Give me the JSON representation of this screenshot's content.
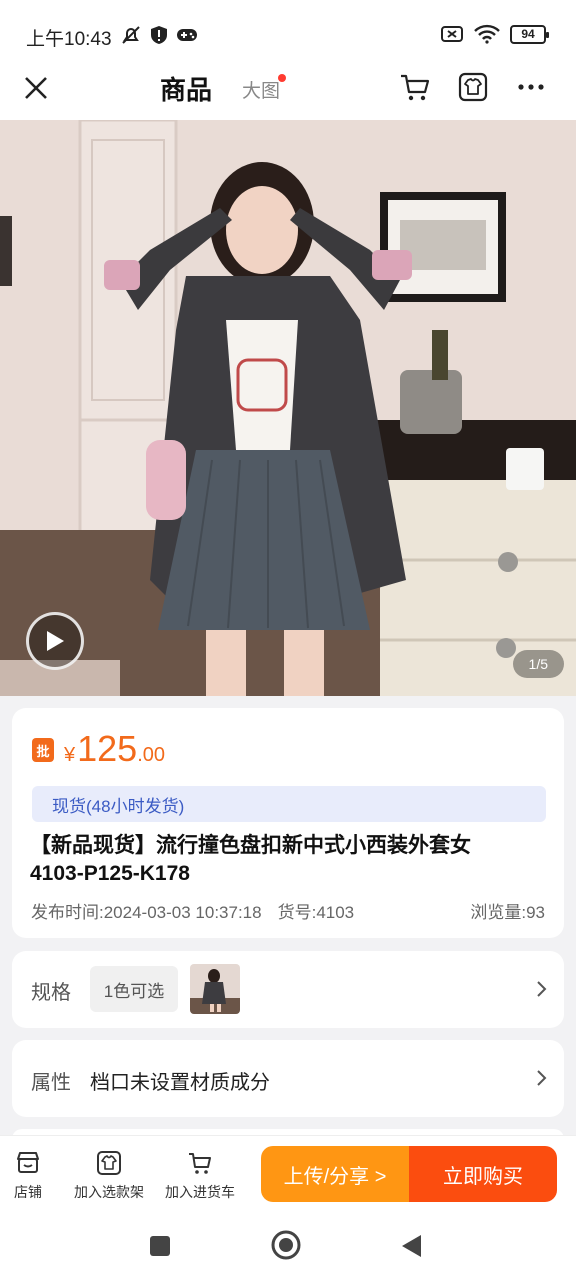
{
  "status_bar": {
    "time": "上午10:43",
    "battery": "94"
  },
  "nav": {
    "tab_active": "商品",
    "tab_inactive": "大图"
  },
  "hero": {
    "image_counter": "1/5"
  },
  "product": {
    "badge": "批",
    "price_symbol": "¥",
    "price_integer": "125",
    "price_decimal": ".00",
    "stock_tag": "现货(48小时发货)",
    "title_line1": "【新品现货】流行撞色盘扣新中式小西装外套女",
    "title_line2": "4103-P125-K178",
    "publish_time": "发布时间:2024-03-03 10:37:18",
    "item_no": "货号:4103",
    "views": "浏览量:93"
  },
  "spec": {
    "label": "规格",
    "chip": "1色可选"
  },
  "attr": {
    "label": "属性",
    "value": "档口未设置材质成分"
  },
  "actions": {
    "store": "店铺",
    "add_shelf": "加入选款架",
    "add_cart": "加入进货车",
    "share": "上传/分享 >",
    "buy": "立即购买"
  },
  "colors": {
    "accent_orange": "#f26a1b",
    "share_button": "#ff9613",
    "buy_button": "#fb4d0f",
    "stock_tag_bg": "#e8ecfb",
    "stock_tag_text": "#3b5bc4"
  },
  "icons": [
    "close-icon",
    "cart-icon",
    "shirt-icon",
    "more-icon",
    "play-icon",
    "chevron-right-icon",
    "store-icon",
    "recent-apps-icon",
    "home-icon",
    "back-icon"
  ]
}
